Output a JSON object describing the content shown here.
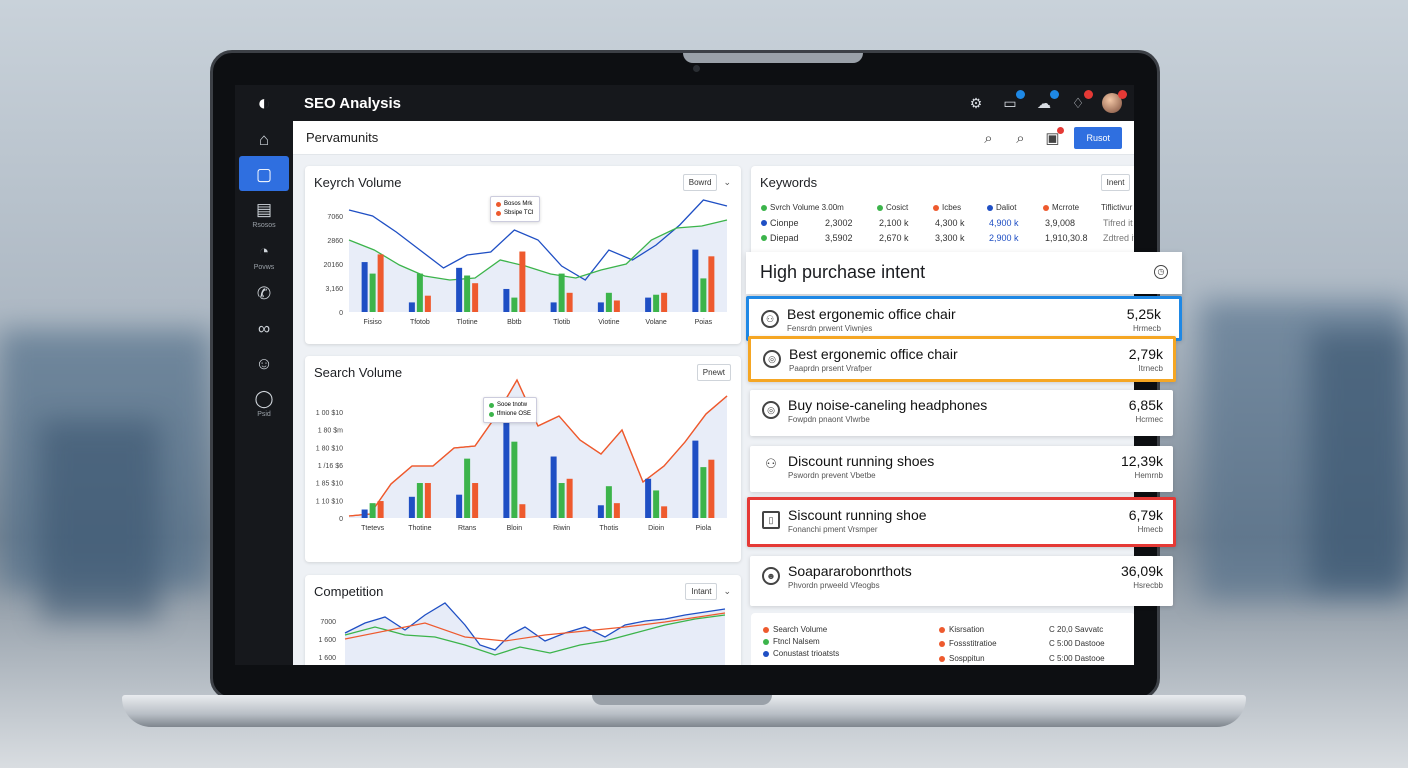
{
  "app": {
    "title": "SEO Analysis"
  },
  "header": {
    "page_title": "Pervamunits",
    "report_label": "Rusot"
  },
  "sidebar": {
    "items": [
      {
        "label": "",
        "icon": "home-icon"
      },
      {
        "label": "",
        "icon": "dashboard-icon"
      },
      {
        "label": "Rsosos",
        "icon": "folder-icon"
      },
      {
        "label": "Povws",
        "icon": "gauge-icon"
      },
      {
        "label": "",
        "icon": "phone-icon"
      },
      {
        "label": "",
        "icon": "link-icon"
      },
      {
        "label": "",
        "icon": "smile-icon"
      },
      {
        "label": "Psid",
        "icon": "chat-icon"
      }
    ]
  },
  "colors": {
    "blue": "#1f4fc4",
    "green": "#3cb44b",
    "red": "#ee5a2e",
    "accent": "#2f6fe0",
    "highlight_blue": "#1e88e5",
    "highlight_orange": "#f5a623",
    "highlight_red": "#e53935"
  },
  "search_volume_card": {
    "title": "Keyrch Volume",
    "select": "Bowrd",
    "tooltip": [
      "Bosos Mrk",
      "Sbsipe  TCI"
    ],
    "chart_data": {
      "type": "bar",
      "y_ticks": [
        "7060",
        "2860",
        "20160",
        "3,160",
        "0"
      ],
      "categories": [
        "Fisiso",
        "Tfotob",
        "Tlotine",
        "Bbtb",
        "Tlotib",
        "Viotine",
        "Volane",
        "Poias"
      ],
      "series": [
        {
          "values": [
            52,
            10,
            46,
            24,
            10,
            10,
            15,
            65
          ]
        },
        {
          "values": [
            40,
            40,
            38,
            15,
            40,
            20,
            18,
            35
          ]
        },
        {
          "values": [
            60,
            17,
            30,
            63,
            20,
            12,
            20,
            58
          ]
        }
      ]
    }
  },
  "search_volume2_card": {
    "title": "Search Volume",
    "select": "Pnewt",
    "tooltip": [
      "Sooe tnotw",
      "tfmione  OSE"
    ],
    "chart_data": {
      "type": "bar",
      "y_ticks": [
        "1 00 $10",
        "1 80 $m",
        "1 80 $10",
        "1 /16 $6",
        "1 85 $10",
        "1 10 $10",
        "0"
      ],
      "categories": [
        "Ttetevs",
        "Thotine",
        "Rtans",
        "Bloin",
        "Riwin",
        "Thotis",
        "Dioin",
        "Piola"
      ],
      "series": [
        {
          "values": [
            8,
            20,
            22,
            100,
            58,
            12,
            37,
            73
          ]
        },
        {
          "values": [
            14,
            33,
            56,
            72,
            33,
            30,
            26,
            48
          ]
        },
        {
          "values": [
            16,
            33,
            33,
            13,
            37,
            14,
            11,
            55
          ]
        }
      ]
    }
  },
  "competition_card": {
    "title": "Competition",
    "select": "Intant",
    "y_ticks": [
      "7000",
      "1 600",
      "1 600"
    ]
  },
  "keywords_card": {
    "title": "Keywords",
    "select": "Inent",
    "columns": [
      "Svrch Volume 3.00m",
      "Cosict",
      "Icbes",
      "Daliot",
      "Mcrrote",
      "Tiflictivur"
    ],
    "rows": [
      [
        "Cionpe",
        "2,3002",
        "2,100 k",
        "4,300 k",
        "4,900 k",
        "3,9,008",
        "Tifred it"
      ],
      [
        "Diepad",
        "3,5902",
        "2,670 k",
        "3,300 k",
        "2,900 k",
        "1,910,30.8",
        "Zdtred it"
      ]
    ]
  },
  "intent": {
    "title": "High purchase intent",
    "items": [
      {
        "title": "Best ergonemic office chair",
        "sub": "Fensrdn prwent Viwnjes",
        "value": "5,25k",
        "value_sub": "Hrmecb",
        "icon": "people-icon",
        "border": "blue"
      },
      {
        "title": "Best ergonemic office chair",
        "sub": "Paaprdn prsent Vrafper",
        "value": "2,79k",
        "value_sub": "Itrnecb",
        "icon": "target-icon",
        "border": "orange"
      },
      {
        "title": "Buy noise-caneling headphones",
        "sub": "Fowpdn pnaont Vlwrbe",
        "value": "6,85k",
        "value_sub": "Hcrmec",
        "icon": "target-icon",
        "border": "none"
      },
      {
        "title": "Discount running shoes",
        "sub": "Pswordn prevent Vbetbe",
        "value": "12,39k",
        "value_sub": "Hemrnb",
        "icon": "people-icon",
        "border": "none"
      },
      {
        "title": "Siscount running shoe",
        "sub": "Fonanchi pment Vrsmper",
        "value": "6,79k",
        "value_sub": "Hmecb",
        "icon": "phone-icon",
        "border": "red"
      },
      {
        "title": "Soapararobonrthots",
        "sub": "Phvordn prweeld Vfeogbs",
        "value": "36,09k",
        "value_sub": "Hsrecbb",
        "icon": "person-icon",
        "border": "none"
      }
    ]
  },
  "bottom_legend": {
    "left": [
      {
        "label": "Search Volume",
        "color": "#ee5a2e"
      },
      {
        "label": "Ftncl Nalsem",
        "color": "#3cb44b"
      },
      {
        "label": "Conustast trioatsts",
        "color": "#1f4fc4"
      }
    ],
    "mid": [
      {
        "label": "Kisrsation",
        "color": "#ee5a2e"
      },
      {
        "label": "Fossstitratioe",
        "color": "#ee5a2e"
      },
      {
        "label": "Sosppitun",
        "color": "#ee5a2e"
      }
    ],
    "right": [
      "C 20,0 Savvatc",
      "C 5:00 Dastooe",
      "C 5:00 Dastooe"
    ]
  }
}
